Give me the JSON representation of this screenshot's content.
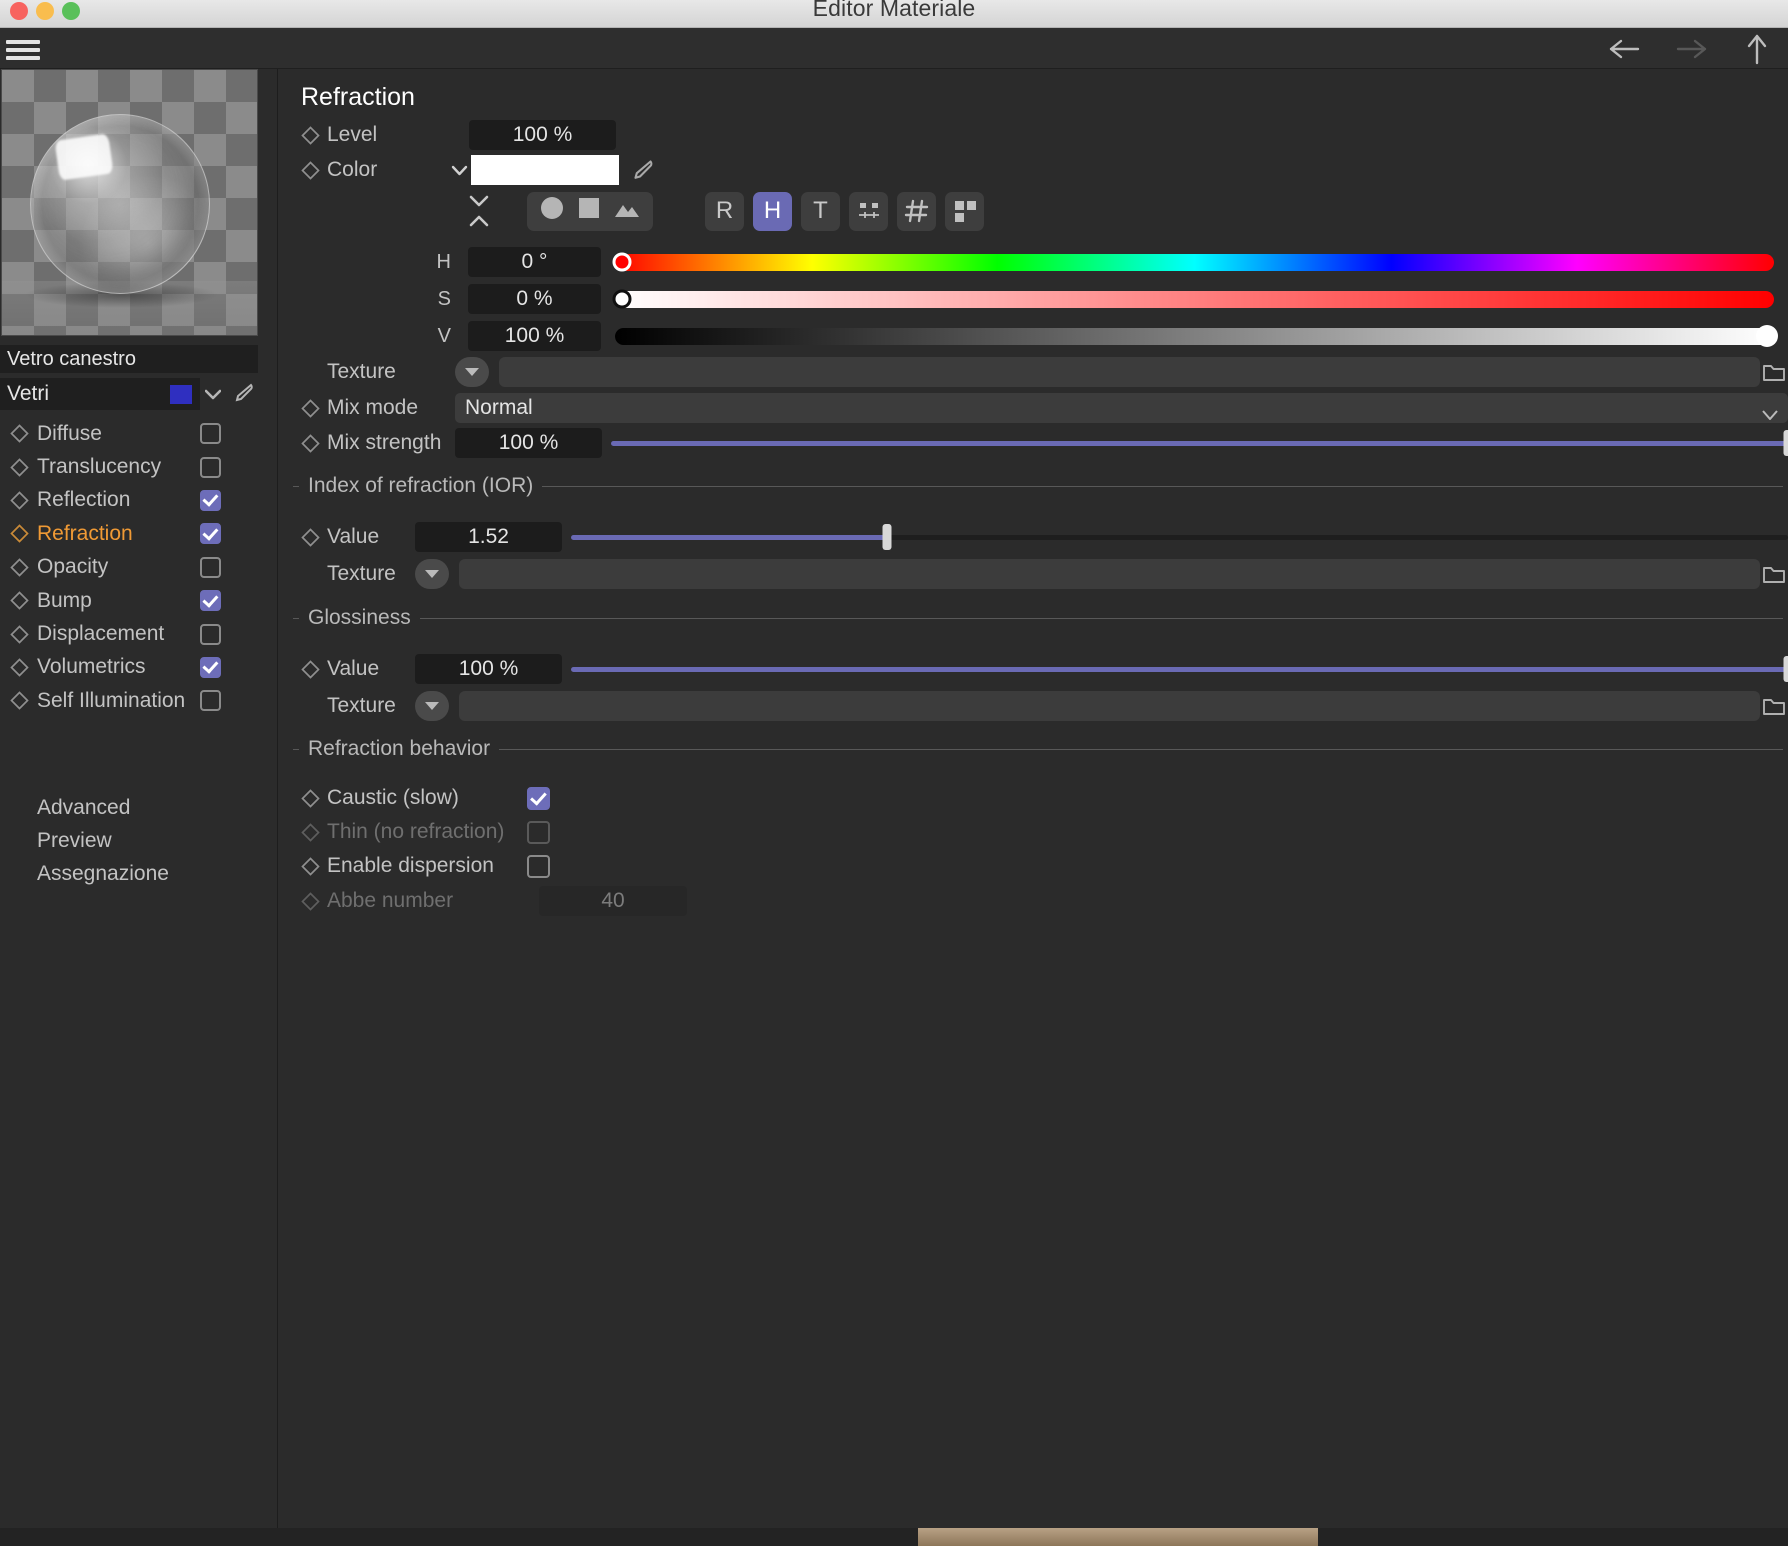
{
  "window": {
    "title": "Editor Materiale",
    "traffic_lights": [
      "close",
      "minimize",
      "zoom"
    ]
  },
  "toolbar": {
    "menu_icon": "hamburger-icon",
    "back_icon": "arrow-left-icon",
    "forward_icon": "arrow-right-icon",
    "up_icon": "arrow-up-icon"
  },
  "sidebar": {
    "material_name": "Vetro canestro",
    "group_name": "Vetri",
    "group_color": "#2f2fc0",
    "channels": [
      {
        "label": "Diffuse",
        "checked": false,
        "active": false
      },
      {
        "label": "Translucency",
        "checked": false,
        "active": false
      },
      {
        "label": "Reflection",
        "checked": true,
        "active": false
      },
      {
        "label": "Refraction",
        "checked": true,
        "active": true
      },
      {
        "label": "Opacity",
        "checked": false,
        "active": false
      },
      {
        "label": "Bump",
        "checked": true,
        "active": false
      },
      {
        "label": "Displacement",
        "checked": false,
        "active": false
      },
      {
        "label": "Volumetrics",
        "checked": true,
        "active": false
      },
      {
        "label": "Self Illumination",
        "checked": false,
        "active": false
      }
    ],
    "links": [
      "Advanced",
      "Preview",
      "Assegnazione"
    ]
  },
  "main": {
    "title": "Refraction",
    "level": {
      "label": "Level",
      "value": "100 %"
    },
    "color": {
      "label": "Color",
      "swatch": "#ffffff",
      "eyedropper_icon": "eyedropper-icon"
    },
    "color_tools": {
      "collapse_icon": "collapse-expand-icon",
      "shape_buttons": [
        "circle-icon",
        "square-icon",
        "image-icon"
      ],
      "mode_buttons": [
        {
          "label": "R",
          "active": false
        },
        {
          "label": "H",
          "active": true
        },
        {
          "label": "T",
          "active": false
        }
      ],
      "slider_icon": "sliders-icon",
      "hash_icon": "hash-icon",
      "grid_icon": "grid-swatches-icon"
    },
    "hsv": [
      {
        "label": "H",
        "value": "0 °",
        "pos": 0.3
      },
      {
        "label": "S",
        "value": "0 %",
        "pos": 0.3
      },
      {
        "label": "V",
        "value": "100 %",
        "pos": 99.3
      }
    ],
    "texture_top": {
      "label": "Texture",
      "value": ""
    },
    "mix_mode": {
      "label": "Mix mode",
      "value": "Normal"
    },
    "mix_strength": {
      "label": "Mix strength",
      "value": "100 %",
      "fill": 100
    },
    "ior_section": {
      "title": "Index of refraction (IOR)",
      "value": {
        "label": "Value",
        "value": "1.52",
        "fill": 26
      },
      "texture": {
        "label": "Texture",
        "value": ""
      }
    },
    "gloss_section": {
      "title": "Glossiness",
      "value": {
        "label": "Value",
        "value": "100 %",
        "fill": 100
      },
      "texture": {
        "label": "Texture",
        "value": ""
      }
    },
    "behavior_section": {
      "title": "Refraction behavior",
      "caustic": {
        "label": "Caustic (slow)",
        "checked": true,
        "enabled": true
      },
      "thin": {
        "label": "Thin (no refraction)",
        "checked": false,
        "enabled": false
      },
      "dispersion": {
        "label": "Enable dispersion",
        "checked": false,
        "enabled": true
      },
      "abbe": {
        "label": "Abbe number",
        "value": "40",
        "enabled": false
      }
    }
  },
  "colors": {
    "accent": "#6a6ab4",
    "active_channel": "#f09a35",
    "panel_bg": "#2b2b2b"
  }
}
